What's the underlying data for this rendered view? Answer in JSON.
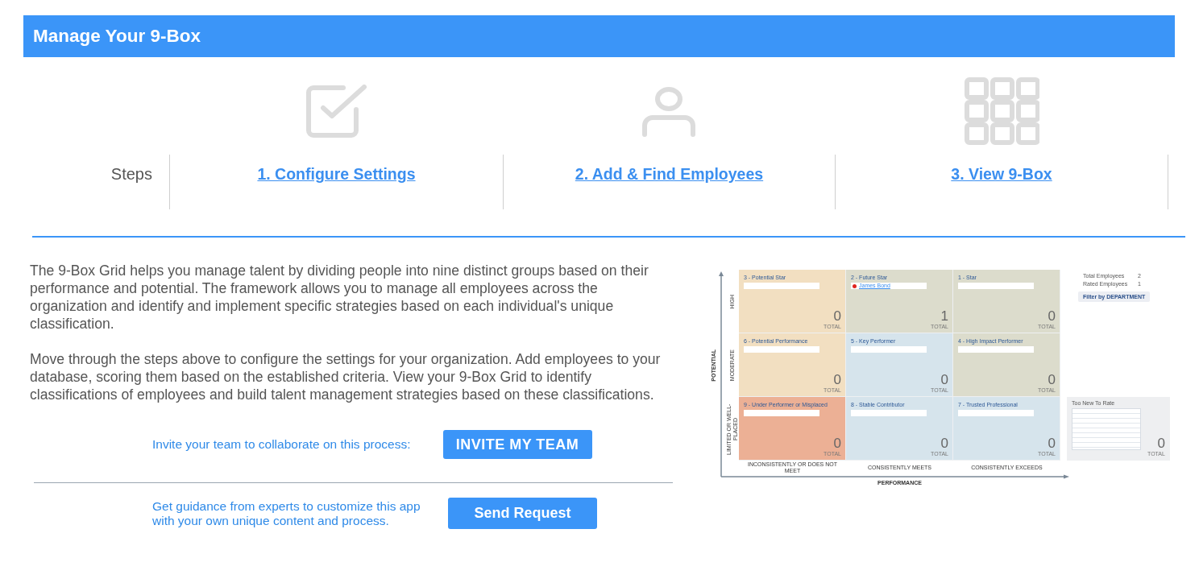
{
  "header": {
    "title": "Manage Your 9-Box"
  },
  "steps": {
    "label": "Steps",
    "items": [
      {
        "kind": "checkbox",
        "label": "1. Configure Settings"
      },
      {
        "kind": "person",
        "label": "2. Add & Find Employees"
      },
      {
        "kind": "grid",
        "label": "3. View 9-Box"
      }
    ]
  },
  "intro": {
    "paragraphs": [
      "The 9-Box Grid helps you manage talent by dividing people into nine distinct groups based on their performance and potential. The framework allows you to manage all employees across the organization and identify and implement specific strategies based on each individual's unique classification.",
      "Move through the steps above to configure the settings for your organization. Add employees to your database, scoring them based on the established criteria. View your 9-Box Grid to identify classifications of employees and build talent management strategies based on these classifications."
    ]
  },
  "invite": {
    "text": "Invite your team to collaborate on this process:",
    "button": "INVITE MY TEAM"
  },
  "request": {
    "text": "Get guidance from experts to customize this app with your own unique content and process.",
    "button": "Send Request"
  },
  "preview": {
    "y_axis": {
      "title": "POTENTIAL",
      "levels": [
        "HIGH",
        "MODERATE",
        "LIMITED OR WELL-PLACED"
      ]
    },
    "x_axis": {
      "title": "PERFORMANCE",
      "levels": [
        "INCONSISTENTLY OR DOES NOT MEET",
        "CONSISTENTLY MEETS",
        "CONSISTENTLY EXCEEDS"
      ]
    },
    "cells": [
      {
        "title": "3 - Potential Star",
        "color": "#f2dfc1",
        "count": "0",
        "count_label": "TOTAL"
      },
      {
        "title": "2 - Future Star",
        "color": "#dcdccc",
        "employees": [
          {
            "name": "James Bond"
          }
        ],
        "count": "1",
        "count_label": "TOTAL"
      },
      {
        "title": "1 - Star",
        "color": "#dcdccc",
        "count": "0",
        "count_label": "TOTAL"
      },
      {
        "title": "6 - Potential Performance",
        "color": "#f2dfc1",
        "count": "0",
        "count_label": "TOTAL"
      },
      {
        "title": "5 - Key Performer",
        "color": "#d6e4ec",
        "count": "0",
        "count_label": "TOTAL"
      },
      {
        "title": "4 - High Impact Performer",
        "color": "#dcdccc",
        "count": "0",
        "count_label": "TOTAL"
      },
      {
        "title": "9 - Under Performer or Misplaced",
        "color": "#ecb095",
        "count": "0",
        "count_label": "TOTAL"
      },
      {
        "title": "8 - Stable Contributor",
        "color": "#d6e4ec",
        "count": "0",
        "count_label": "TOTAL"
      },
      {
        "title": "7 - Trusted Professional",
        "color": "#d6e4ec",
        "count": "0",
        "count_label": "TOTAL"
      }
    ],
    "stats": [
      {
        "label": "Total Employees",
        "value": "2"
      },
      {
        "label": "Rated Employees",
        "value": "1"
      }
    ],
    "filter_button": "Filter by DEPARTMENT",
    "too_new": {
      "title": "Too New To Rate",
      "count": "0",
      "count_label": "TOTAL"
    }
  }
}
